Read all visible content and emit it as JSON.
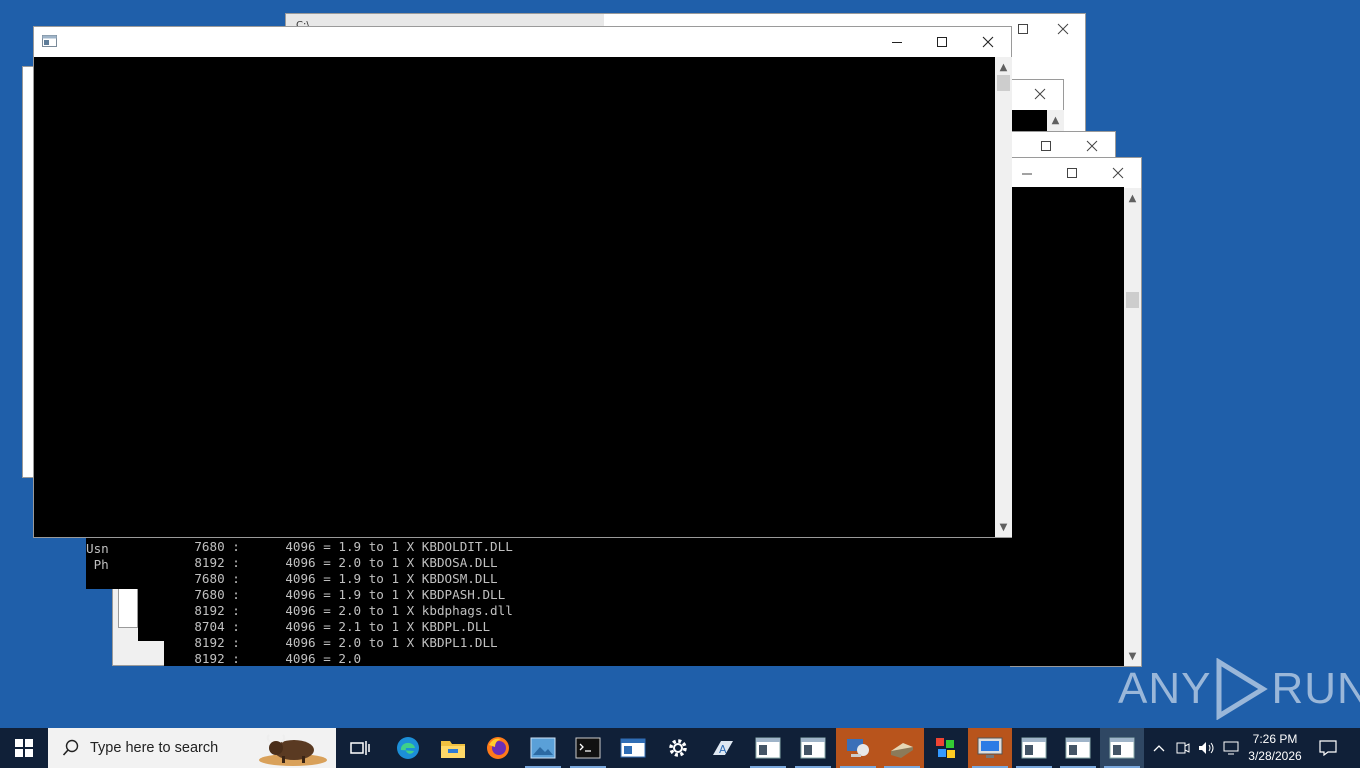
{
  "background_window": {
    "title": "C:\\"
  },
  "mid_window": {
    "lines": [
      {
        "text": "Usn"
      },
      {
        "text": " Ph"
      }
    ]
  },
  "front_console": {
    "lines": [
      "    7680 :      4096 = 1.9 to 1 X KBDOLDIT.DLL",
      "    8192 :      4096 = 2.0 to 1 X KBDOSA.DLL",
      "    7680 :      4096 = 1.9 to 1 X KBDOSM.DLL",
      "    7680 :      4096 = 1.9 to 1 X KBDPASH.DLL",
      "    8192 :      4096 = 2.0 to 1 X kbdphags.dll",
      "    8704 :      4096 = 2.1 to 1 X KBDPL.DLL",
      "    8192 :      4096 = 2.0 to 1 X KBDPL1.DLL",
      "    8192 :      4096 = 2.0"
    ]
  },
  "main_window": {
    "title": ""
  },
  "taskbar": {
    "search_placeholder": "Type here to search",
    "clock_time": "7:26 PM",
    "clock_date": "3/28/2026",
    "apps": [
      "task-view-icon",
      "edge-icon",
      "file-explorer-icon",
      "firefox-icon",
      "photos-icon",
      "cmd-icon",
      "window-app-icon",
      "settings-icon",
      "wordpad-icon",
      "console-window-icon",
      "console-window-icon",
      "remote-desktop-icon",
      "scanner-icon",
      "colorful-app-icon",
      "monitor-icon",
      "console-window-icon",
      "console-window-icon",
      "console-window-icon"
    ]
  },
  "watermark": {
    "text_left": "ANY",
    "text_right": "RUN"
  },
  "colors": {
    "desktop": "#1f5faa",
    "taskbar": "#102038",
    "accent": "#7aa8dd"
  }
}
